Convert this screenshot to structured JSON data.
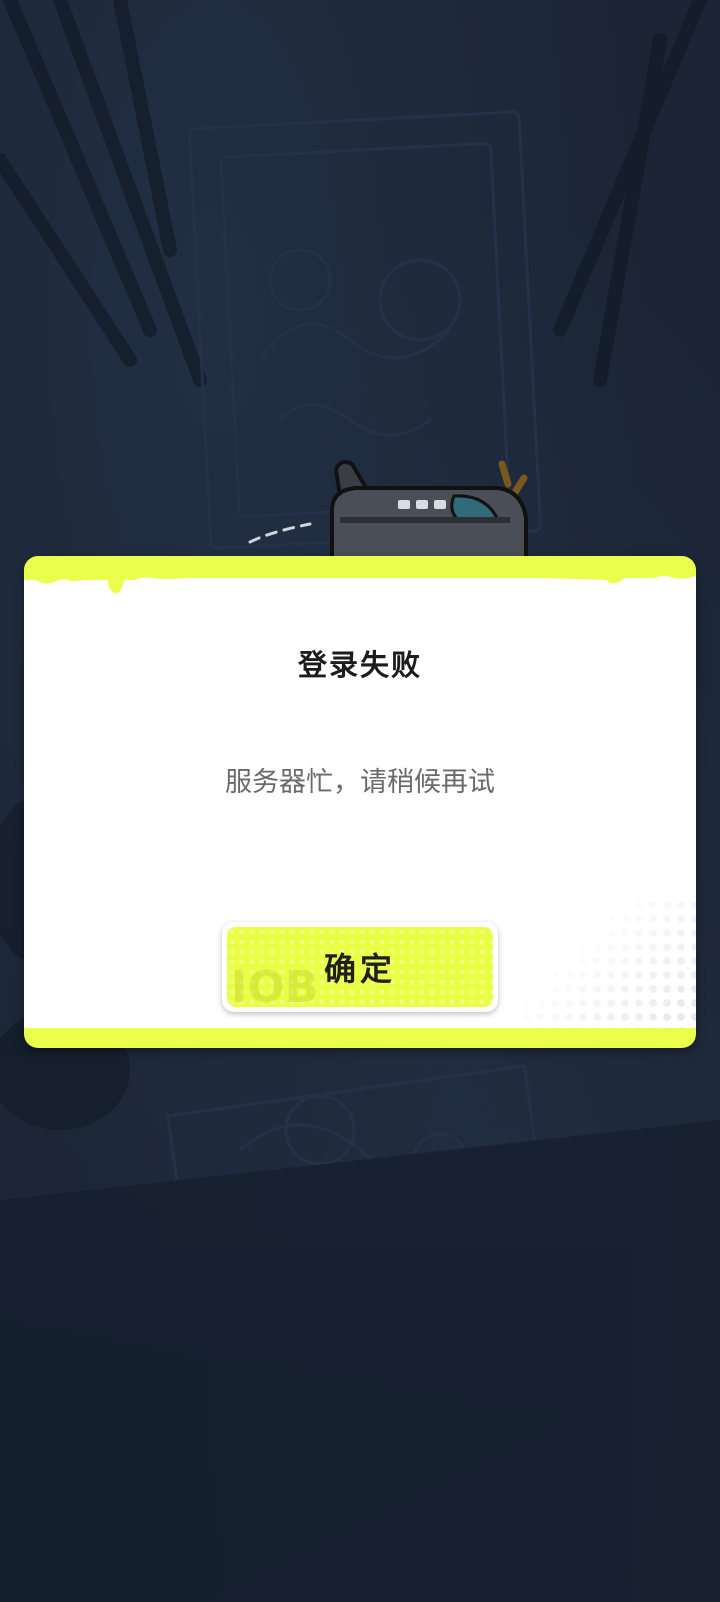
{
  "dialog": {
    "title": "登录失败",
    "message": "服务器忙，请稍候再试",
    "confirm_label": "确定"
  },
  "icons": {
    "plane": "airplane-icon"
  },
  "colors": {
    "background": "#1b2535",
    "accent": "#eaff4c",
    "dialog_body": "#ffffff",
    "title_text": "#1c1c1c",
    "message_text": "#6a6a6a"
  }
}
